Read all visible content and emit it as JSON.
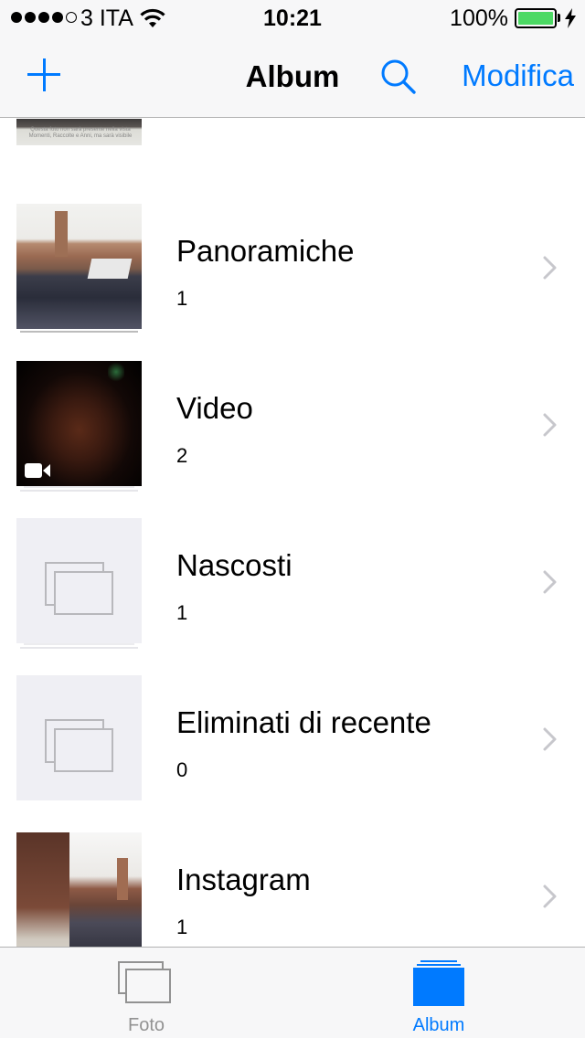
{
  "status_bar": {
    "carrier": "3 ITA",
    "time": "10:21",
    "battery_percent": "100%",
    "signal_strength": 4,
    "battery_level": 1.0,
    "charging": true
  },
  "nav_bar": {
    "title": "Album",
    "edit_label": "Modifica",
    "accent_color": "#007aff"
  },
  "albums": [
    {
      "title": "Panoramiche",
      "count": "1",
      "thumb": "panorama"
    },
    {
      "title": "Video",
      "count": "2",
      "thumb": "video"
    },
    {
      "title": "Nascosti",
      "count": "1",
      "thumb": "empty-placeholder"
    },
    {
      "title": "Eliminati di recente",
      "count": "0",
      "thumb": "empty-placeholder"
    },
    {
      "title": "Instagram",
      "count": "1",
      "thumb": "instagram"
    }
  ],
  "partial_thumb_text": "Questa foto non sarà presente nella vista Momenti, Raccolte e Anni, ma sarà visibile",
  "tab_bar": {
    "tabs": [
      {
        "label": "Foto",
        "icon": "photos-stack-icon",
        "selected": false
      },
      {
        "label": "Album",
        "icon": "albums-stack-icon",
        "selected": true
      }
    ],
    "selected_color": "#007aff",
    "unselected_color": "#929292"
  }
}
